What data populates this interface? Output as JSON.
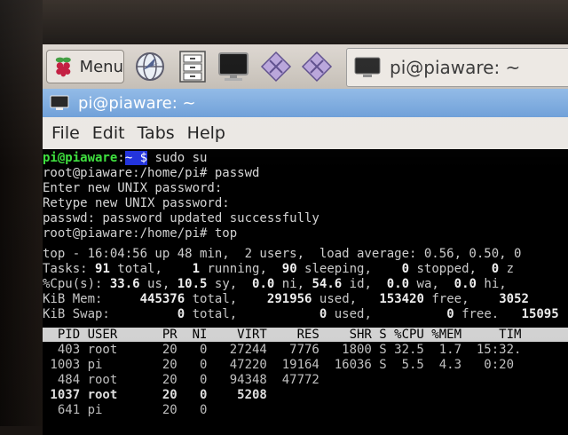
{
  "taskbar": {
    "menu_label": "Menu",
    "task_window_label": "pi@piaware: ~"
  },
  "window": {
    "title": "pi@piaware: ~",
    "menus": [
      "File",
      "Edit",
      "Tabs",
      "Help"
    ]
  },
  "terminal": {
    "prompt_user": "pi@piaware",
    "prompt_sep": ":",
    "prompt_path": "~ $",
    "cmd1": " sudo su",
    "line_passwd": "root@piaware:/home/pi# passwd",
    "line_enter": "Enter new UNIX password:",
    "line_retype": "Retype new UNIX password:",
    "line_updated": "passwd: password updated successfully",
    "line_top": "root@piaware:/home/pi# top",
    "top_line1": "top - 16:04:56 up 48 min,  2 users,  load average: 0.56, 0.50, 0",
    "tasks_label": "Tasks:",
    "tasks_total": "91",
    "tasks_total_lbl": " total,",
    "tasks_running": "1",
    "tasks_running_lbl": " running,",
    "tasks_sleeping": "90",
    "tasks_sleeping_lbl": " sleeping,",
    "tasks_stopped": "0",
    "tasks_stopped_lbl": " stopped,",
    "tasks_zombie": "0",
    "tasks_zombie_lbl": " z",
    "cpu_label": "%Cpu(s):",
    "cpu_us": "33.6",
    "cpu_us_lbl": " us,",
    "cpu_sy": "10.5",
    "cpu_sy_lbl": " sy,",
    "cpu_ni": "0.0",
    "cpu_ni_lbl": " ni,",
    "cpu_id": "54.6",
    "cpu_id_lbl": " id,",
    "cpu_wa": "0.0",
    "cpu_wa_lbl": " wa,",
    "cpu_hi": "0.0",
    "cpu_hi_lbl": " hi,",
    "mem_label": "KiB Mem:",
    "mem_total": "445376",
    "mem_total_lbl": " total,",
    "mem_used": "291956",
    "mem_used_lbl": " used,",
    "mem_free": "153420",
    "mem_free_lbl": " free,",
    "mem_buffers": "3052",
    "swap_label": "KiB Swap:",
    "swap_total": "0",
    "swap_total_lbl": " total,",
    "swap_used": "0",
    "swap_used_lbl": " used,",
    "swap_free": "0",
    "swap_free_lbl": " free.",
    "swap_cached": "15095",
    "columns": "  PID USER      PR  NI    VIRT    RES    SHR S %CPU %MEM     TIM",
    "rows": [
      "  403 root      20   0   27244   7776   1800 S 32.5  1.7  15:32.",
      " 1003 pi        20   0   47220  19164  16036 S  5.5  4.3   0:20",
      "  484 root      20   0   94348  47772",
      " 1037 root      20   0    5208",
      "  641 pi        20   0"
    ]
  }
}
